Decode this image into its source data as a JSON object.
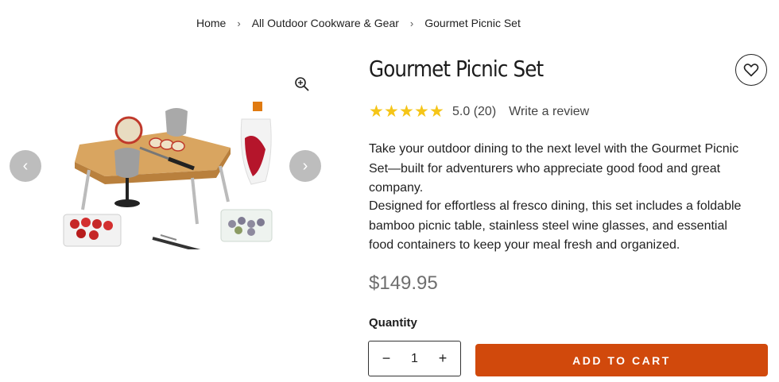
{
  "breadcrumb": {
    "items": [
      "Home",
      "All Outdoor Cookware & Gear",
      "Gourmet Picnic Set"
    ],
    "separator": "›"
  },
  "product": {
    "title": "Gourmet Picnic Set",
    "rating": "5.0",
    "review_count": "(20)",
    "stars": 5,
    "write_review": "Write a review",
    "description_1": "Take your outdoor dining to the next level with the Gourmet Picnic Set—built for adventurers who appreciate good food and great company.",
    "description_2": "Designed for effortless al fresco dining, this set includes a foldable bamboo picnic table, stainless steel wine glasses, and essential food containers to keep your meal fresh and organized.",
    "price": "$149.95"
  },
  "quantity": {
    "label": "Quantity",
    "value": "1",
    "minus": "−",
    "plus": "+"
  },
  "cart": {
    "label": "ADD TO CART"
  },
  "gallery": {
    "prev": "‹",
    "next": "›",
    "icons": {
      "zoom": "zoom-in-icon",
      "wishlist": "heart-icon"
    }
  },
  "colors": {
    "accent": "#d1490c",
    "star": "#f5c518",
    "price": "#6e6e6e",
    "nav_arrow": "#bdbdbd"
  }
}
